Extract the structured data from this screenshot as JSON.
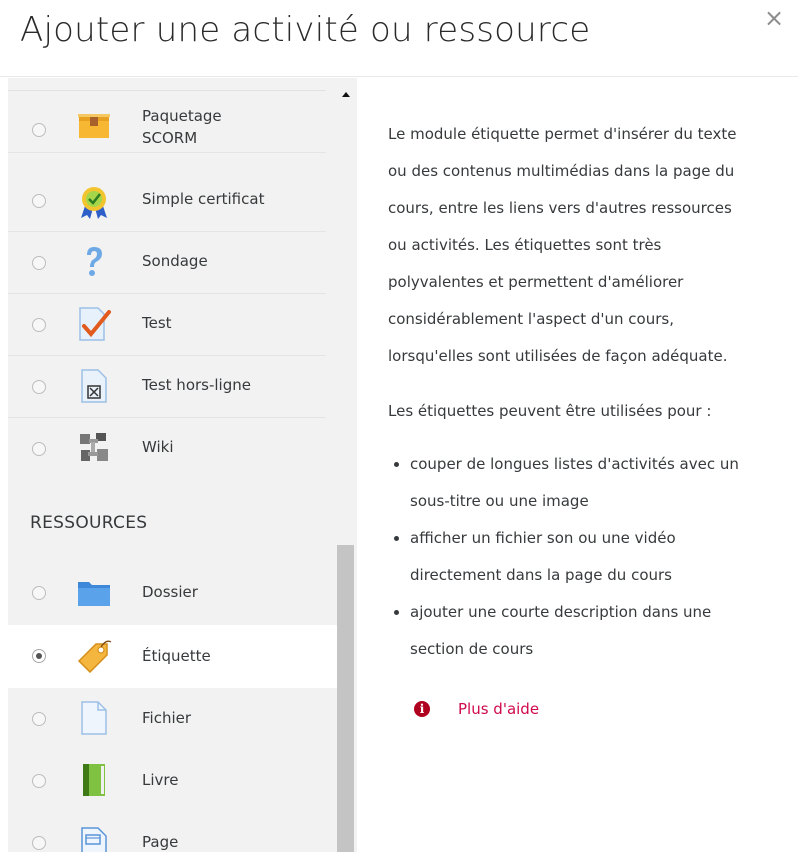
{
  "modal": {
    "title": "Ajouter une activité ou ressource",
    "close_icon": "×"
  },
  "activities": [
    {
      "label_line1": "Paquetage",
      "label_line2": "SCORM",
      "icon": "scorm-package-icon",
      "selected": false
    },
    {
      "label": "Simple certificat",
      "icon": "certificate-icon",
      "selected": false
    },
    {
      "label": "Sondage",
      "icon": "question-mark-icon",
      "selected": false
    },
    {
      "label": "Test",
      "icon": "quiz-checkmark-icon",
      "selected": false
    },
    {
      "label": "Test hors-ligne",
      "icon": "offline-quiz-icon",
      "selected": false
    },
    {
      "label": "Wiki",
      "icon": "wiki-icon",
      "selected": false
    }
  ],
  "resources_heading": "RESSOURCES",
  "resources": [
    {
      "label": "Dossier",
      "icon": "folder-icon",
      "selected": false
    },
    {
      "label": "Étiquette",
      "icon": "label-tag-icon",
      "selected": true
    },
    {
      "label": "Fichier",
      "icon": "file-icon",
      "selected": false
    },
    {
      "label": "Livre",
      "icon": "book-icon",
      "selected": false
    },
    {
      "label": "Page",
      "icon": "page-icon",
      "selected": false
    }
  ],
  "description": {
    "lines1": [
      "Le module étiquette permet d'insérer du texte",
      "ou des contenus multimédias dans la page du",
      "cours, entre les liens vers d'autres ressources",
      "ou activités. Les étiquettes sont très",
      "polyvalentes et permettent d'améliorer",
      "considérablement l'aspect d'un cours,",
      "lorsqu'elles sont utilisées de façon adéquate."
    ],
    "paragraph2": "Les étiquettes peuvent être utilisées pour :",
    "bullets": [
      {
        "line1": "couper de longues listes d'activités avec un",
        "line2": "sous-titre ou une image"
      },
      {
        "line1": "afficher un fichier son ou une vidéo",
        "line2": "directement dans la page du cours"
      },
      {
        "line1": "ajouter une courte description dans une",
        "line2": "section de cours"
      }
    ]
  },
  "help": {
    "icon_glyph": "i",
    "label": "Plus d'aide"
  },
  "colors": {
    "link": "#cf0a4b",
    "panel_bg": "#f2f2f2",
    "help_icon": "#b00020"
  }
}
